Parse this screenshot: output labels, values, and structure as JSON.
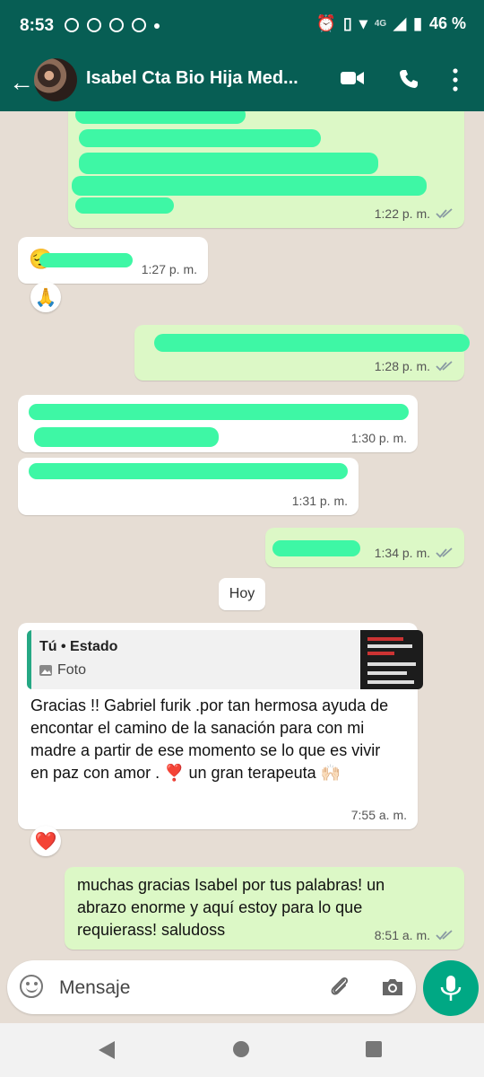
{
  "status_bar": {
    "time": "8:53",
    "network": "4G",
    "battery": "46 %"
  },
  "header": {
    "title": "Isabel Cta Bio Hija Med..."
  },
  "messages": [
    {
      "time": "1:22 p. m."
    },
    {
      "time": "1:27 p. m.",
      "reaction": "🙏"
    },
    {
      "time": "1:28 p. m."
    },
    {
      "time": "1:30 p. m."
    },
    {
      "time": "1:31 p. m."
    },
    {
      "time": "1:34 p. m."
    }
  ],
  "date_chip": "Hoy",
  "quoted_message": {
    "reply_to": "Tú • Estado",
    "reply_kind": "Foto",
    "text": "Gracias !! Gabriel furik .por tan hermosa ayuda de encontar el camino de la sanación para con mi madre a partir de ese momento se lo que es vivir en paz con amor . ❣️ un gran terapeuta 🙌🏻",
    "time": "7:55 a. m.",
    "reaction": "❤️"
  },
  "last_message": {
    "text": "muchas gracias Isabel por tus palabras! un abrazo enorme y aquí estoy para lo que requierass! saludoss",
    "time": "8:51 a. m."
  },
  "composer": {
    "placeholder": "Mensaje"
  },
  "colors": {
    "header": "#075e54",
    "outgoing": "#dcf8c6",
    "incoming": "#ffffff",
    "mic": "#00a884",
    "redaction": "#3ef7a5"
  }
}
